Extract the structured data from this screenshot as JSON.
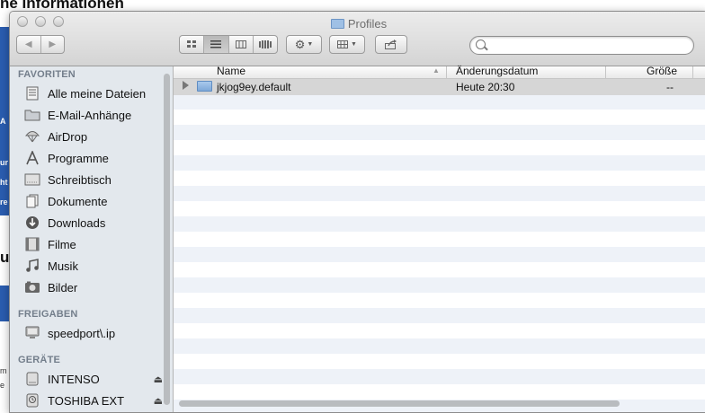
{
  "background": {
    "heading": "ne Informationen",
    "letters": [
      "A",
      "ur",
      "ht",
      "re",
      "m",
      "e"
    ],
    "heading2": "u"
  },
  "window": {
    "title": "Profiles",
    "search": {
      "placeholder": ""
    }
  },
  "sidebar": {
    "sections": [
      {
        "title": "FAVORITEN",
        "items": [
          {
            "label": "Alle meine Dateien",
            "icon": "all-files-icon"
          },
          {
            "label": "E-Mail-Anhänge",
            "icon": "folder-icon"
          },
          {
            "label": "AirDrop",
            "icon": "airdrop-icon"
          },
          {
            "label": "Programme",
            "icon": "applications-icon"
          },
          {
            "label": "Schreibtisch",
            "icon": "desktop-icon"
          },
          {
            "label": "Dokumente",
            "icon": "documents-icon"
          },
          {
            "label": "Downloads",
            "icon": "downloads-icon"
          },
          {
            "label": "Filme",
            "icon": "movies-icon"
          },
          {
            "label": "Musik",
            "icon": "music-icon"
          },
          {
            "label": "Bilder",
            "icon": "pictures-icon"
          }
        ]
      },
      {
        "title": "FREIGABEN",
        "items": [
          {
            "label": "speedport\\.ip",
            "icon": "network-computer-icon"
          }
        ]
      },
      {
        "title": "GERÄTE",
        "items": [
          {
            "label": "INTENSO",
            "icon": "drive-icon"
          },
          {
            "label": "TOSHIBA EXT",
            "icon": "timemachine-drive-icon"
          }
        ]
      }
    ]
  },
  "list": {
    "columns": {
      "name": "Name",
      "date": "Änderungsdatum",
      "size": "Größe"
    },
    "rows": [
      {
        "name": "jkjog9ey.default",
        "date": "Heute 20:30",
        "size": "--"
      }
    ]
  }
}
